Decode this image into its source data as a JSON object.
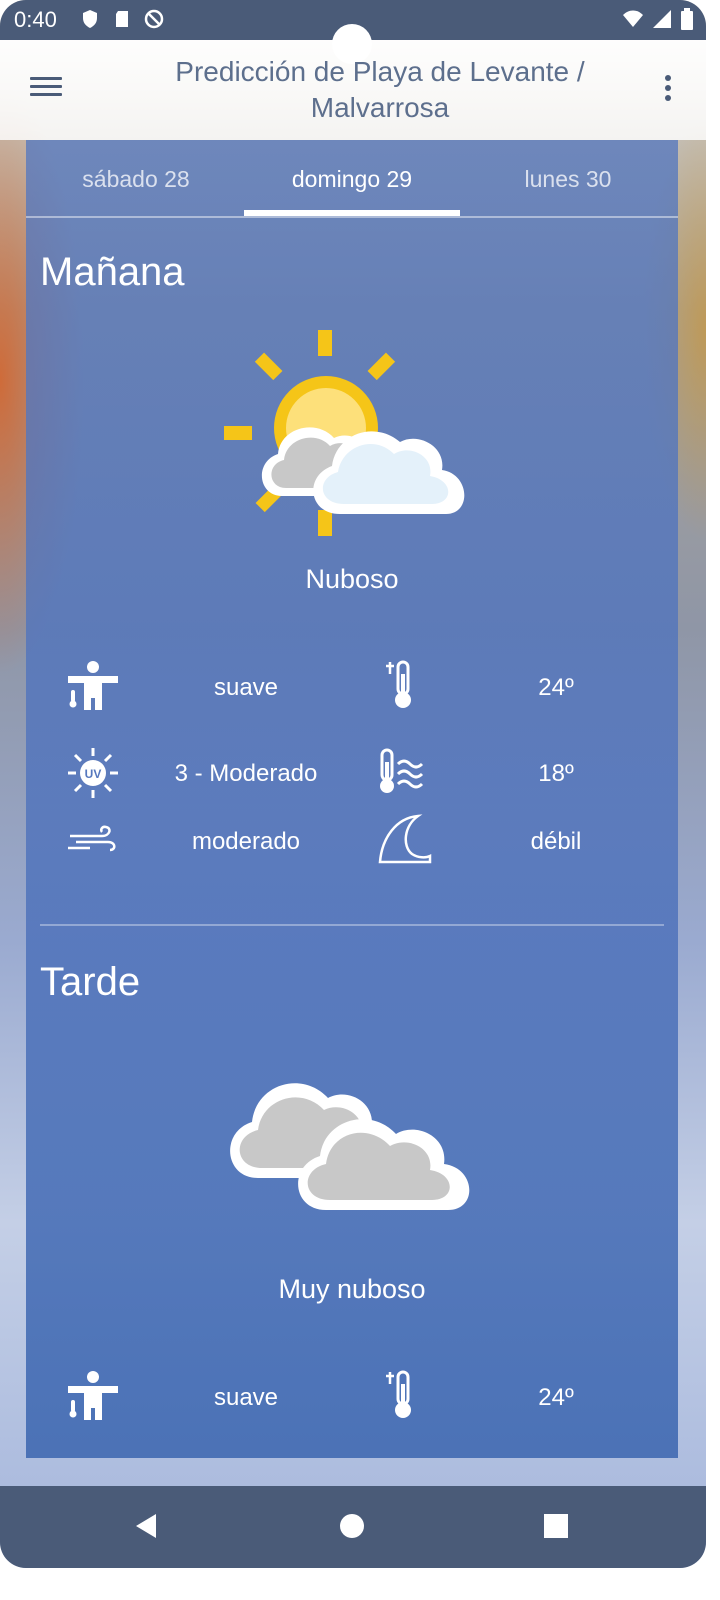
{
  "status_bar": {
    "time": "0:40",
    "icons": [
      "shield-icon",
      "sd-card-icon",
      "no-disturb-icon",
      "wifi-icon",
      "signal-icon",
      "battery-icon"
    ]
  },
  "app_bar": {
    "title": "Predicción de Playa de Levante / Malvarrosa",
    "menu_icon": "hamburger-menu-icon",
    "more_icon": "more-vert-icon"
  },
  "tabs": [
    {
      "label": "sábado 28",
      "active": false
    },
    {
      "label": "domingo 29",
      "active": true
    },
    {
      "label": "lunes 30",
      "active": false
    }
  ],
  "morning": {
    "title": "Mañana",
    "condition": "Nuboso",
    "condition_icon": "partly-cloudy-icon",
    "rows": [
      {
        "left_icon": "thermal-sensation-icon",
        "left_value": "suave",
        "right_icon": "air-temperature-icon",
        "right_value": "24º"
      },
      {
        "left_icon": "uv-index-icon",
        "left_value": "3 - Moderado",
        "right_icon": "water-temperature-icon",
        "right_value": "18º"
      },
      {
        "left_icon": "wind-icon",
        "left_value": "moderado",
        "right_icon": "waves-icon",
        "right_value": "débil"
      }
    ]
  },
  "afternoon": {
    "title": "Tarde",
    "condition": "Muy nuboso",
    "condition_icon": "very-cloudy-icon",
    "rows": [
      {
        "left_icon": "thermal-sensation-icon",
        "left_value": "suave",
        "right_icon": "air-temperature-icon",
        "right_value": "24º"
      }
    ]
  },
  "nav_bar": [
    "back-icon",
    "home-icon",
    "recents-icon"
  ],
  "colors": {
    "system_bar": "#4a5b78",
    "panel": "#5678be",
    "sun": "#f5c518",
    "cloud_grey": "#c8c8c8",
    "cloud_light": "#e4f1fa"
  }
}
